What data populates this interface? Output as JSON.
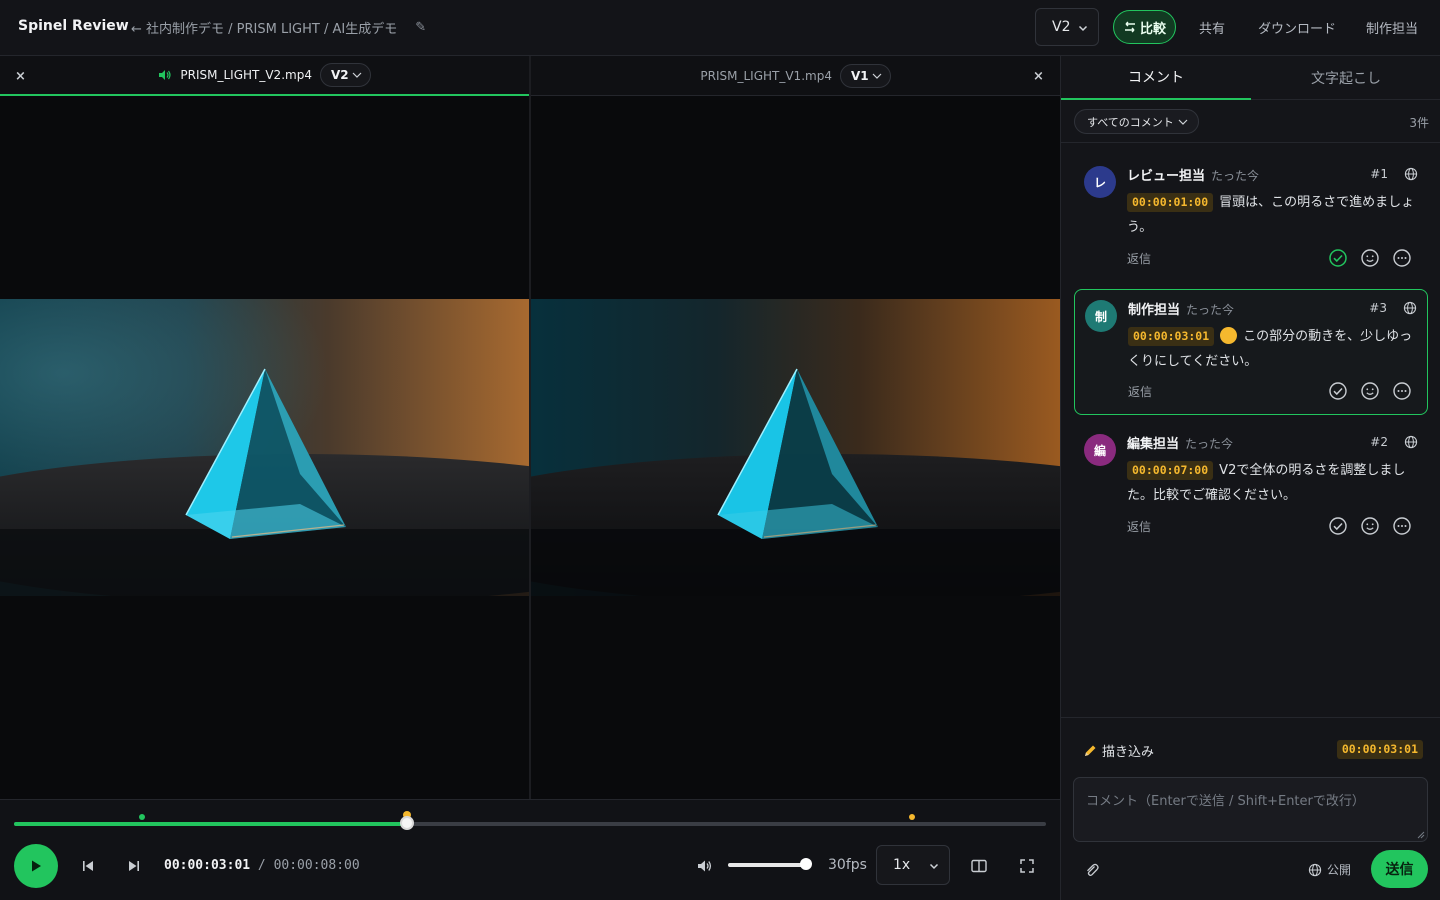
{
  "header": {
    "brand": "Spinel Review",
    "breadcrumb": "← 社内制作デモ / PRISM LIGHT / AI生成デモ",
    "edit_glyph": "✎",
    "version_select": "V2",
    "compare_label": "比較",
    "share_label": "共有",
    "download_label": "ダウンロード",
    "user_label": "制作担当"
  },
  "panes": {
    "left": {
      "filename": "PRISM_LIGHT_V2.mp4",
      "version": "V2",
      "close": "×"
    },
    "right": {
      "filename": "PRISM_LIGHT_V1.mp4",
      "version": "V1",
      "close": "×"
    }
  },
  "player": {
    "current_time": "00:00:03:01",
    "separator": "/",
    "duration": "00:00:08:00",
    "progress_fraction": 0.381,
    "volume_fraction": 1.0,
    "fps": "30fps",
    "speed": "1x",
    "markers": [
      {
        "fraction": 0.124,
        "color": "#22c55e"
      },
      {
        "fraction": 0.381,
        "color": "#f5b82e"
      },
      {
        "fraction": 0.87,
        "color": "#f5b82e"
      }
    ]
  },
  "sidebar": {
    "tabs": [
      "コメント",
      "文字起こし"
    ],
    "filter_label": "すべてのコメント",
    "count": "3件",
    "comments": [
      {
        "avatar": "レ",
        "avatar_color": "#2c3a8c",
        "author": "レビュー担当",
        "time": "たった今",
        "number": "#1",
        "timecode": "00:00:01:00",
        "text": "冒頭は、この明るさで進めましょう。",
        "reply": "返信",
        "resolved": true
      },
      {
        "avatar": "制",
        "avatar_color": "#1e7a74",
        "author": "制作担当",
        "time": "たった今",
        "number": "#3",
        "timecode": "00:00:03:01",
        "text": "この部分の動きを、少しゆっくりにしてください。",
        "reply": "返信",
        "resolved": false
      },
      {
        "avatar": "編",
        "avatar_color": "#8a2a7e",
        "author": "編集担当",
        "time": "たった今",
        "number": "#2",
        "timecode": "00:00:07:00",
        "text": "V2で全体の明るさを調整しました。比較でご確認ください。",
        "reply": "返信",
        "resolved": false
      }
    ],
    "composer": {
      "draw_label": "描き込み",
      "timecode": "00:00:03:01",
      "placeholder": "コメント（Enterで送信 / Shift+Enterで改行）",
      "visibility": "公開",
      "send": "送信"
    }
  }
}
